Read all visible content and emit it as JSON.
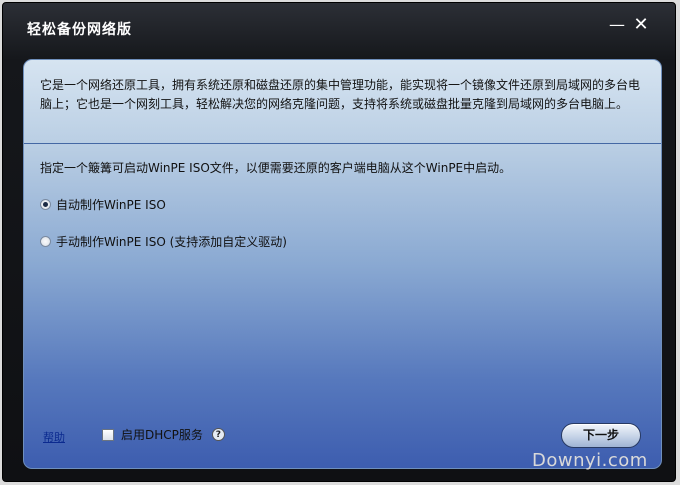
{
  "window": {
    "title": "轻松备份网络版",
    "minimize_glyph": "—",
    "close_glyph": "✕"
  },
  "description": "它是一个网络还原工具，拥有系统还原和磁盘还原的集中管理功能，能实现将一个镜像文件还原到局域网的多台电脑上；它也是一个网刻工具，轻松解决您的网络克隆问题，支持将系统或磁盘批量克隆到局域网的多台电脑上。",
  "instruction": "指定一个簸篝可启动WinPE ISO文件，以便需要还原的客户端电脑从这个WinPE中启动。",
  "options": [
    {
      "label": "自动制作WinPE ISO",
      "selected": true
    },
    {
      "label": "手动制作WinPE ISO (支持添加自定义驱动)",
      "selected": false
    }
  ],
  "footer": {
    "help_label": "帮助",
    "dhcp_label": "启用DHCP服务",
    "dhcp_checked": false,
    "info_glyph": "?",
    "next_label": "下一步"
  },
  "watermark": "Downyi.com"
}
